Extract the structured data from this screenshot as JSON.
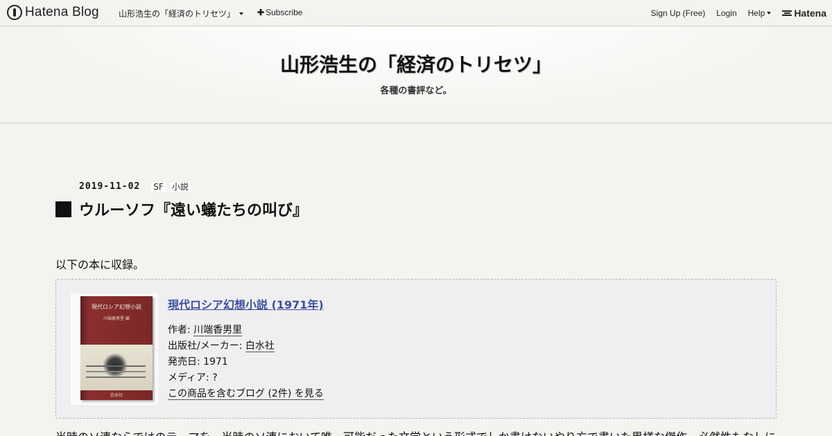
{
  "topbar": {
    "brand": "Hatena Blog",
    "blog_name": "山形浩生の「経済のトリセツ」",
    "subscribe": "Subscribe",
    "signup": "Sign Up (Free)",
    "login": "Login",
    "help": "Help",
    "hatena": "Hatena"
  },
  "header": {
    "title": "山形浩生の「経済のトリセツ」",
    "description": "各種の書評など。"
  },
  "entry": {
    "date": "2019-11-02",
    "categories": [
      "SF",
      "小説"
    ],
    "title": "ウルーソフ『遠い蟻たちの叫び』",
    "intro": "以下の本に収録。",
    "body_visible": "当時のソ連ならではのテーマを、当時のソ連において唯一可能だった文学という形式でしか書けないやり方で書いた異様な傑作。必然性もなしに"
  },
  "product": {
    "cover_title": "現代ロシア幻想小説",
    "cover_author": "川端香男里 編",
    "cover_publisher": "白水社",
    "title": "現代ロシア幻想小説 (1971年)",
    "author_label": "作者:",
    "author": "川端香男里",
    "publisher_label": "出版社/メーカー:",
    "publisher": "白水社",
    "release_label": "発売日:",
    "release": "1971",
    "media_label": "メディア:",
    "media": "?",
    "blogs_link": "この商品を含むブログ (2件) を見る"
  }
}
